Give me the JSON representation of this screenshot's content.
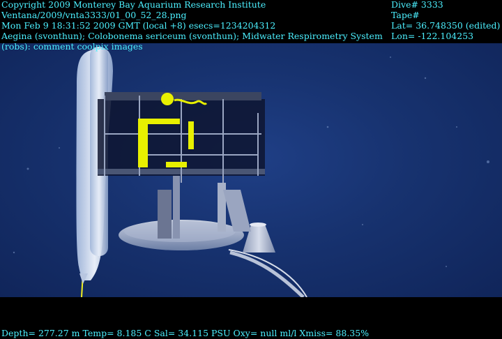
{
  "header": {
    "left_lines": [
      "Copyright 2009 Monterey Bay Aquarium Research Institute",
      "Ventana/2009/vnta3333/01_00_52_28.png",
      "Mon Feb  9 18:31:52 2009 GMT (local +8)  esecs=1234204312",
      "Aegina (svonthun); Colobonema sericeum (svonthun); Midwater Respirometry System",
      "(robs): comment coolpix images"
    ],
    "right_lines": [
      "Dive# 3333",
      "Tape#",
      "Lat= 36.748350 (edited)",
      "Lon= -122.104253"
    ]
  },
  "footer": {
    "line": "Depth= 277.27 m  Temp= 8.185 C  Sal= 34.115 PSU  Oxy= null ml/l  Xmiss= 88.35%"
  },
  "scene": {
    "subject": "midwater-respirometry-system",
    "water_color": "#17326f",
    "overlay_color": "#4cf0ff"
  }
}
